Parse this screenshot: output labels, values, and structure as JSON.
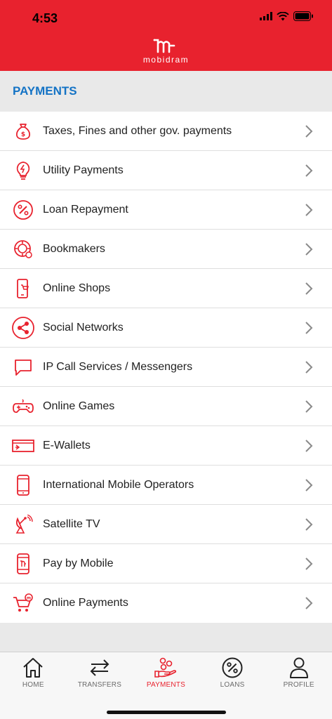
{
  "status": {
    "time": "4:53"
  },
  "brand": {
    "logo_text": "mobidram",
    "accent": "#e8222e",
    "title_color": "#1473c5"
  },
  "section": {
    "title": "PAYMENTS"
  },
  "items": [
    {
      "label": "Taxes, Fines and other gov. payments",
      "icon": "money-bag-icon"
    },
    {
      "label": "Utility Payments",
      "icon": "lightbulb-icon"
    },
    {
      "label": "Loan Repayment",
      "icon": "percent-circle-icon"
    },
    {
      "label": "Bookmakers",
      "icon": "chip-icon"
    },
    {
      "label": "Online Shops",
      "icon": "phone-cart-icon"
    },
    {
      "label": "Social Networks",
      "icon": "share-icon"
    },
    {
      "label": "IP Call Services / Messengers",
      "icon": "chat-icon"
    },
    {
      "label": "Online Games",
      "icon": "gamepad-icon"
    },
    {
      "label": "E-Wallets",
      "icon": "wallet-icon"
    },
    {
      "label": "International Mobile Operators",
      "icon": "mobile-phone-icon"
    },
    {
      "label": "Satellite TV",
      "icon": "satellite-dish-icon"
    },
    {
      "label": "Pay by Mobile",
      "icon": "mobile-m-icon"
    },
    {
      "label": "Online Payments",
      "icon": "cart-icon"
    }
  ],
  "tabs": [
    {
      "label": "HOME",
      "icon": "home-icon",
      "active": false
    },
    {
      "label": "TRANSFERS",
      "icon": "transfer-arrows-icon",
      "active": false
    },
    {
      "label": "PAYMENTS",
      "icon": "payments-hand-icon",
      "active": true
    },
    {
      "label": "LOANS",
      "icon": "percent-circle-icon",
      "active": false
    },
    {
      "label": "PROFILE",
      "icon": "person-icon",
      "active": false
    }
  ]
}
